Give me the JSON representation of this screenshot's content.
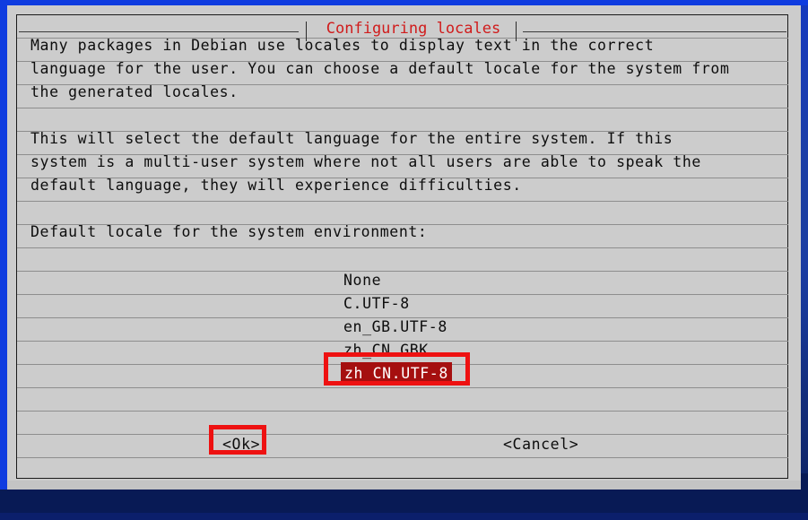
{
  "window": {
    "title": "Configuring locales",
    "title_color": "#d01c1c",
    "terminal_bg": "#cccccc",
    "desktop_bg": "#1437c8"
  },
  "body_text": [
    "Many packages in Debian use locales to display text in the correct",
    "language for the user. You can choose a default locale for the system from",
    "the generated locales.",
    "This will select the default language for the entire system. If this",
    "system is a multi-user system where not all users are able to speak the",
    "default language, they will experience difficulties."
  ],
  "prompt": "Default locale for the system environment:",
  "locale_list": {
    "items": [
      {
        "label": "None",
        "selected": false
      },
      {
        "label": "C.UTF-8",
        "selected": false
      },
      {
        "label": "en_GB.UTF-8",
        "selected": false
      },
      {
        "label": "zh_CN.GBK",
        "selected": false
      },
      {
        "label": "zh_CN.UTF-8",
        "selected": true
      }
    ],
    "selected_value": "zh_CN.UTF-8",
    "selection_bg": "#a50f0f",
    "selection_fg": "#ffffff"
  },
  "buttons": {
    "ok": "<Ok>",
    "cancel": "<Cancel>"
  },
  "annotations": {
    "color": "#ee1111",
    "targets": [
      "zh_CN.UTF-8",
      "<Ok>"
    ]
  }
}
